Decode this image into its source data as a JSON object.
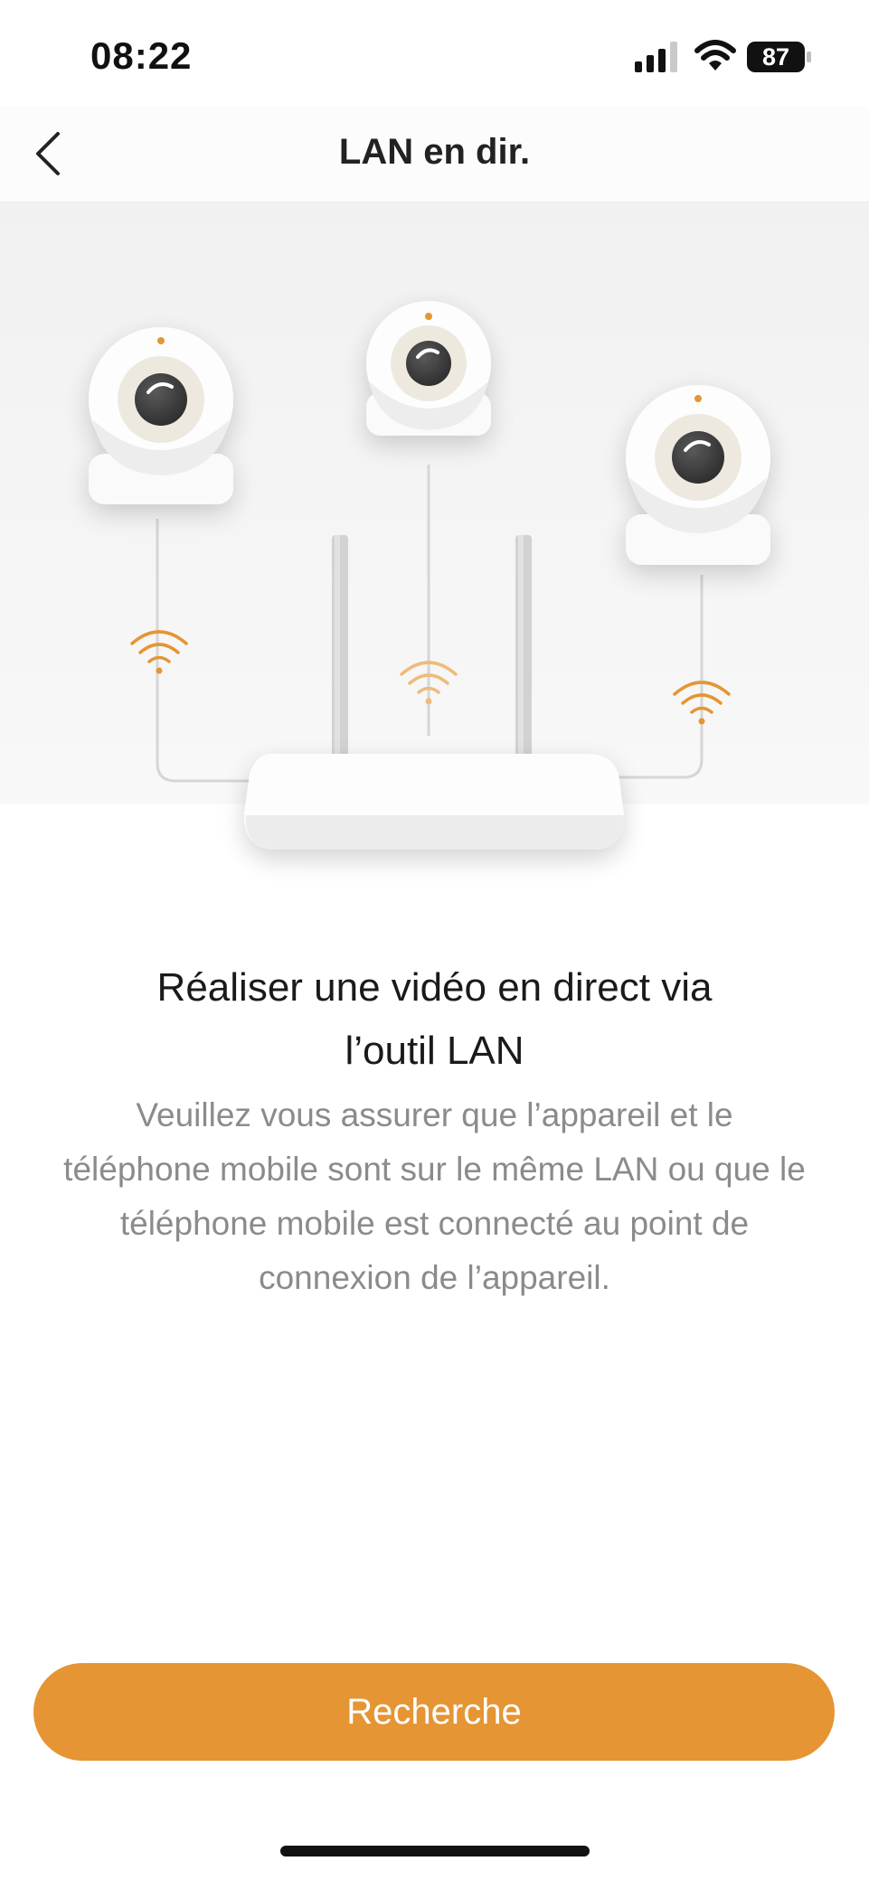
{
  "status_bar": {
    "time": "08:22",
    "battery_level": "87",
    "signal_icon": "cellular-signal-icon",
    "wifi_icon": "wifi-icon",
    "battery_icon": "battery-icon"
  },
  "nav": {
    "title": "LAN en dir.",
    "back_icon": "chevron-left-icon"
  },
  "illustration": {
    "description_icons": [
      "camera-icon",
      "camera-icon",
      "camera-icon",
      "router-icon",
      "wifi-signal-icon"
    ]
  },
  "content": {
    "headline_line1": "Réaliser une vidéo en direct via",
    "headline_line2": "l’outil LAN",
    "description_line1": "Veuillez vous assurer que l’appareil et le",
    "description_line2": "téléphone mobile sont sur le même LAN ou que le",
    "description_line3": "téléphone mobile est connecté au point de",
    "description_line4": "connexion de l’appareil."
  },
  "actions": {
    "search_label": "Recherche"
  },
  "colors": {
    "accent": "#e59534",
    "text_primary": "#1a1a1a",
    "text_secondary": "#8b8b8b"
  }
}
